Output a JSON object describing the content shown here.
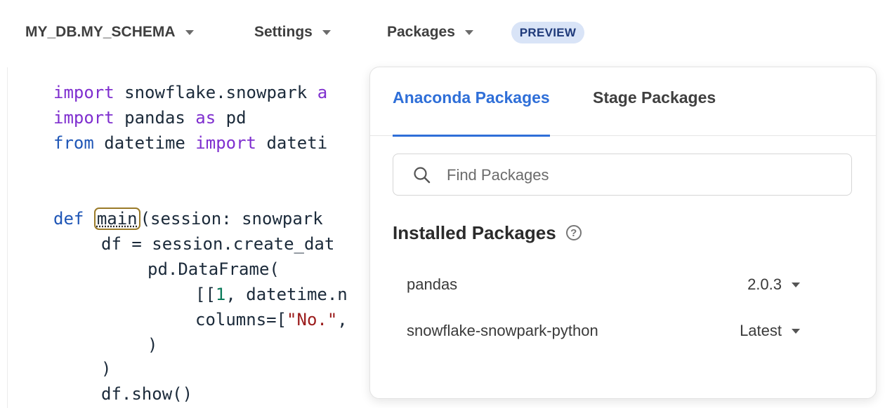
{
  "toolbar": {
    "database": "MY_DB.MY_SCHEMA",
    "settings": "Settings",
    "packages": "Packages",
    "badge": "PREVIEW"
  },
  "editor": {
    "lines": [
      [
        "import snowflake.snowpark a"
      ],
      [
        "import pandas as pd"
      ],
      [
        "from datetime import dateti"
      ],
      [
        "def main(session: snowpark"
      ],
      [
        "df = session.create_dat"
      ],
      [
        "pd.DataFrame("
      ],
      [
        "[[1, datetime.n"
      ],
      [
        "columns=[\"No.\","
      ],
      [
        ")"
      ],
      [
        ")"
      ],
      [
        "df.show()"
      ]
    ],
    "tokens": {
      "l1": [
        "import",
        " snowflake.snowpark ",
        "a"
      ],
      "l2": [
        "import",
        " pandas ",
        "as",
        " pd"
      ],
      "l3": [
        "from",
        " datetime ",
        "import",
        " dateti"
      ],
      "l4": [
        "def",
        " ",
        "main",
        "(session: snowpark"
      ],
      "l5": [
        "df = session.create_dat"
      ],
      "l6": [
        "pd.DataFrame("
      ],
      "l7": [
        "[[",
        "1",
        ", datetime.n"
      ],
      "l8": [
        "columns=[",
        "\"No.\"",
        ","
      ],
      "l9": [
        ")"
      ],
      "l10": [
        ")"
      ],
      "l11": [
        "df.show()"
      ]
    }
  },
  "popover": {
    "tabs": [
      "Anaconda Packages",
      "Stage Packages"
    ],
    "search_placeholder": "Find Packages",
    "installed_title": "Installed Packages",
    "help_glyph": "?",
    "packages": [
      {
        "name": "pandas",
        "version": "2.0.3"
      },
      {
        "name": "snowflake-snowpark-python",
        "version": "Latest"
      }
    ]
  },
  "colors": {
    "accent": "#2f6fd8",
    "badge_bg": "#d9e4f7",
    "keyword": "#7f2fcf",
    "string": "#9b1c1c"
  }
}
